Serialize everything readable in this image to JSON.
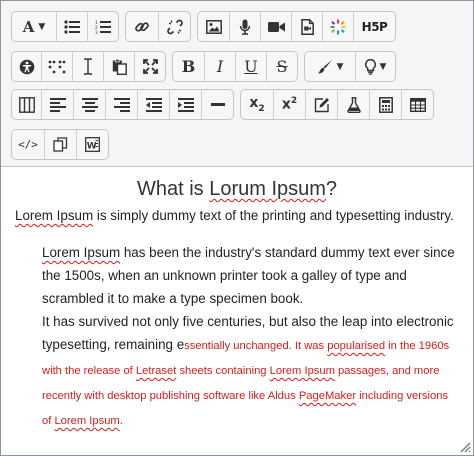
{
  "toolbar": {
    "h5p_label": "H5P",
    "subscript_label": "x",
    "subscript_sub": "2",
    "superscript_label": "x",
    "superscript_sup": "2",
    "bold_label": "B",
    "italic_label": "I",
    "underline_label": "U",
    "strike_label": "S",
    "font_label": "A",
    "code_label": "</>"
  },
  "content": {
    "heading_pre": "What is ",
    "heading_sq": "Lorum Ipsum",
    "heading_post": "?",
    "p1_sq": "Lorem Ipsum",
    "p1_rest": " is simply dummy text of the printing and typesetting industry.",
    "q1_sq": "Lorem Ipsum",
    "q1_rest": " has been the industry's standard dummy text ever since the 1500s, when an unknown printer took a galley of type and scrambled it to make a type specimen book.",
    "q2_text": "It has survived not only five centuries, but also the leap into electronic typesetting, remaining e",
    "q2_red1": "ssentially unchanged. It was ",
    "q2_red_sq1": "popularised",
    "q2_red2": " in the 1960s with the release of ",
    "q2_red_sq2": "Letraset",
    "q2_red3": " sheets containing ",
    "q2_red_sq3": "Lorem Ipsum",
    "q2_red4": " passages, and more recently with desktop publishing software like Aldus ",
    "q2_red_sq4": "PageMaker",
    "q2_red5": " including versions of ",
    "q2_red_sq5": "Lorem Ipsum",
    "q2_red6": "."
  },
  "colors": {
    "spellcheck": "#d81b1b",
    "red_text": "#d21d1d",
    "toolbar_bg": "#f5f5f5"
  }
}
